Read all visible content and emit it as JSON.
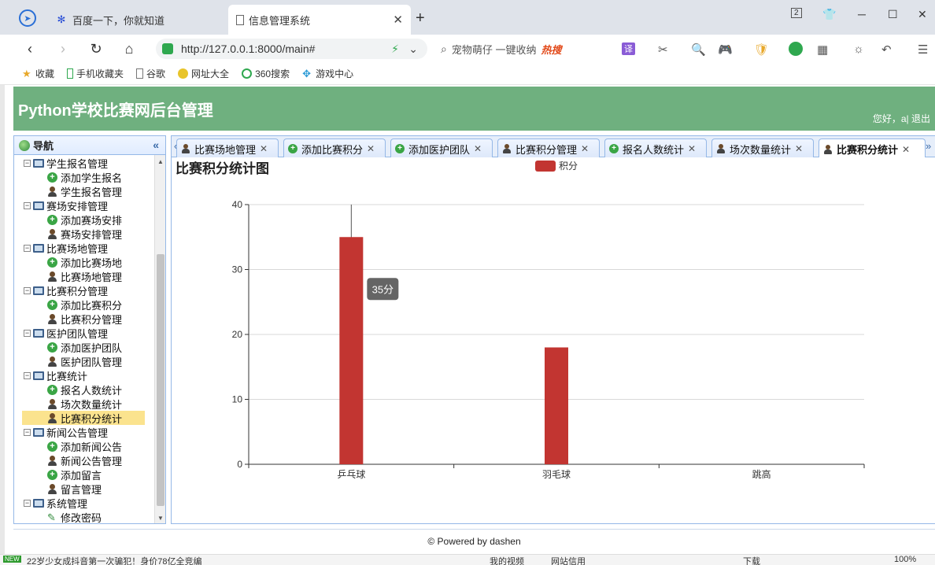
{
  "browser": {
    "tabs": [
      {
        "title": "百度一下，你就知道",
        "icon": "baidu-paw-icon"
      },
      {
        "title": "信息管理系统",
        "icon": "page-icon"
      }
    ],
    "url": "http://127.0.0.1:8000/main#",
    "search_text": "宠物萌仔 一键收纳",
    "hot_label": "热搜",
    "tab_count_badge": "2",
    "bookmarks": [
      "收藏",
      "手机收藏夹",
      "谷歌",
      "网址大全",
      "360搜索",
      "游戏中心"
    ]
  },
  "app": {
    "title": "Python学校比赛网后台管理",
    "greeting": "您好，a| 退出",
    "footer": "© Powered by dashen"
  },
  "sidebar": {
    "title": "导航",
    "collapse_glyph": "«",
    "groups": [
      {
        "label": "学生报名管理",
        "items": [
          {
            "label": "添加学生报名",
            "icon": "add"
          },
          {
            "label": "学生报名管理",
            "icon": "user"
          }
        ]
      },
      {
        "label": "赛场安排管理",
        "items": [
          {
            "label": "添加赛场安排",
            "icon": "add"
          },
          {
            "label": "赛场安排管理",
            "icon": "user"
          }
        ]
      },
      {
        "label": "比赛场地管理",
        "items": [
          {
            "label": "添加比赛场地",
            "icon": "add"
          },
          {
            "label": "比赛场地管理",
            "icon": "user"
          }
        ]
      },
      {
        "label": "比赛积分管理",
        "items": [
          {
            "label": "添加比赛积分",
            "icon": "add"
          },
          {
            "label": "比赛积分管理",
            "icon": "user"
          }
        ]
      },
      {
        "label": "医护团队管理",
        "items": [
          {
            "label": "添加医护团队",
            "icon": "add"
          },
          {
            "label": "医护团队管理",
            "icon": "user"
          }
        ]
      },
      {
        "label": "比赛统计",
        "items": [
          {
            "label": "报名人数统计",
            "icon": "add"
          },
          {
            "label": "场次数量统计",
            "icon": "user"
          },
          {
            "label": "比赛积分统计",
            "icon": "user",
            "selected": true
          }
        ]
      },
      {
        "label": "新闻公告管理",
        "items": [
          {
            "label": "添加新闻公告",
            "icon": "add"
          },
          {
            "label": "新闻公告管理",
            "icon": "user"
          },
          {
            "label": "添加留言",
            "icon": "add"
          },
          {
            "label": "留言管理",
            "icon": "user"
          }
        ]
      },
      {
        "label": "系统管理",
        "items": [
          {
            "label": "修改密码",
            "icon": "pencil"
          }
        ]
      }
    ]
  },
  "page_tabs": [
    {
      "label": "比赛场地管理",
      "icon": "user"
    },
    {
      "label": "添加比赛积分",
      "icon": "add"
    },
    {
      "label": "添加医护团队",
      "icon": "add"
    },
    {
      "label": "比赛积分管理",
      "icon": "user"
    },
    {
      "label": "报名人数统计",
      "icon": "add"
    },
    {
      "label": "场次数量统计",
      "icon": "user"
    },
    {
      "label": "比赛积分统计",
      "icon": "user",
      "active": true
    }
  ],
  "chart_data": {
    "type": "bar",
    "title": "比赛积分统计图",
    "categories": [
      "乒乓球",
      "羽毛球",
      "跳高"
    ],
    "series": [
      {
        "name": "积分",
        "values": [
          35,
          18,
          0
        ],
        "color": "#c23531"
      }
    ],
    "ylim": [
      0,
      40
    ],
    "yticks": [
      0,
      10,
      20,
      30,
      40
    ],
    "grid": true,
    "legend": "top-center",
    "tooltip": {
      "category": "乒乓球",
      "text": "35分"
    }
  },
  "statusbar": {
    "news": "22岁少女成抖音第一次骗犯！身价78亿全竞编",
    "new_badge": "NEW",
    "right_items": [
      "我的视频",
      "网站信用",
      "下载",
      "100%"
    ]
  }
}
